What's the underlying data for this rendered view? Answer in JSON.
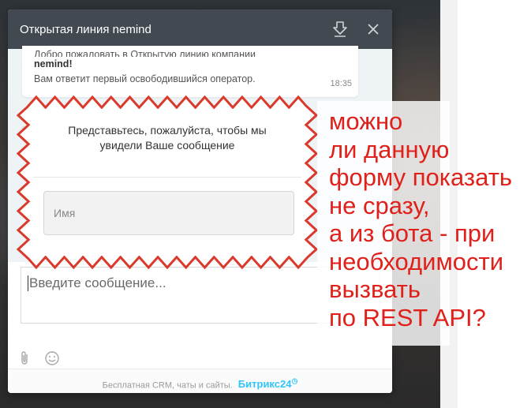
{
  "widget": {
    "title": "Открытая линия nemind",
    "header_icons": [
      "download-icon",
      "close-icon"
    ],
    "header_color": "#424950"
  },
  "message": {
    "line_cut": "Добро пожаловать в Открытую линию компании",
    "line_bold": "nemind!",
    "line_2": "Вам ответит первый освободившийся оператор.",
    "time": "18:35"
  },
  "form": {
    "prompt_line1": "Представьтесь, пожалуйста, чтобы мы",
    "prompt_line2": "увидели Ваше сообщение",
    "name_placeholder": "Имя",
    "zigzag_color": "#d93a2b"
  },
  "composer": {
    "placeholder": "Введите сообщение...",
    "tools": [
      "paperclip-icon",
      "smiley-icon"
    ]
  },
  "footer": {
    "text": "Бесплатная CRM, чаты и сайты.",
    "brand": "Битрикс",
    "brand_num": "24",
    "brand_color": "#2fc6f6"
  },
  "annotation": {
    "lines": [
      "можно",
      "ли данную",
      "форму показать",
      "не сразу,",
      "а из бота - при",
      "необходимости",
      "вызвать",
      "по REST API?"
    ],
    "color": "#e0201b"
  }
}
